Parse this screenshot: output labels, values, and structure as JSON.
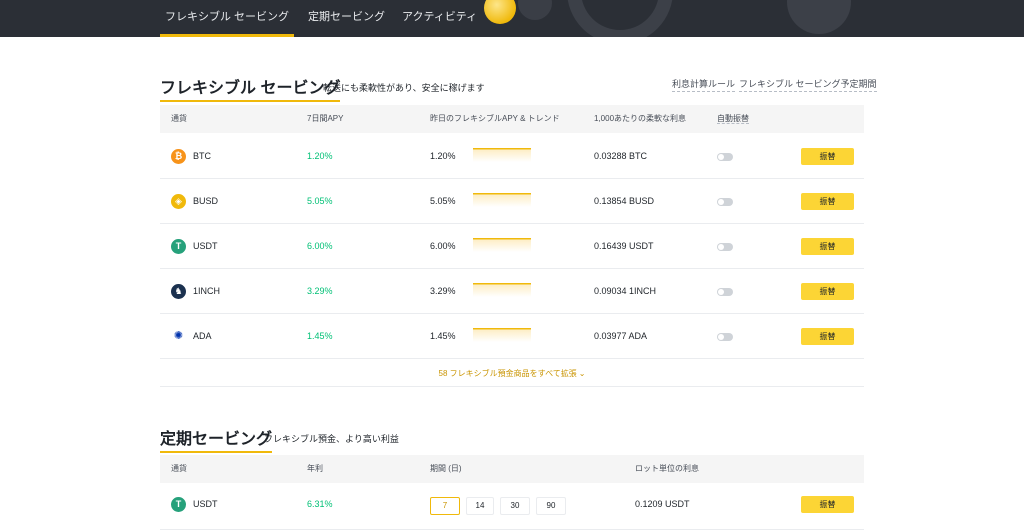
{
  "nav": {
    "tabs": [
      {
        "label": "フレキシブル セービング",
        "active": true
      },
      {
        "label": "定期セービング",
        "active": false
      },
      {
        "label": "アクティビティ",
        "active": false
      }
    ]
  },
  "flexible": {
    "title": "フレキシブル セービング",
    "subtitle": "転送にも柔軟性があり、安全に稼げます",
    "links": [
      "利息計算ルール",
      "フレキシブル セービング予定期間"
    ],
    "headers": [
      "通貨",
      "7日間APY",
      "昨日のフレキシブルAPY & トレンド",
      "1,000あたりの柔軟な利息",
      "自動振替"
    ],
    "rows": [
      {
        "coin": "BTC",
        "apy7": "1.20%",
        "yesterday": "1.20%",
        "interest": "0.03288 BTC",
        "button": "振替",
        "icon": "bitcoin-icon",
        "color": "#f7931a",
        "glyph": "₿"
      },
      {
        "coin": "BUSD",
        "apy7": "5.05%",
        "yesterday": "5.05%",
        "interest": "0.13854 BUSD",
        "button": "振替",
        "icon": "busd-icon",
        "color": "#f0b90b",
        "glyph": "◈"
      },
      {
        "coin": "USDT",
        "apy7": "6.00%",
        "yesterday": "6.00%",
        "interest": "0.16439 USDT",
        "button": "振替",
        "icon": "tether-icon",
        "color": "#26a17b",
        "glyph": "T"
      },
      {
        "coin": "1INCH",
        "apy7": "3.29%",
        "yesterday": "3.29%",
        "interest": "0.09034 1INCH",
        "button": "振替",
        "icon": "1inch-icon",
        "color": "#1b314f",
        "glyph": "♞"
      },
      {
        "coin": "ADA",
        "apy7": "1.45%",
        "yesterday": "1.45%",
        "interest": "0.03977 ADA",
        "button": "振替",
        "icon": "cardano-icon",
        "color": "#ffffff",
        "glyph": "✺"
      }
    ],
    "expand_label": "58 フレキシブル預金商品をすべて拡張"
  },
  "locked": {
    "title": "定期セービング",
    "subtitle": "フレキシブル預金、より高い利益",
    "headers": [
      "通貨",
      "年利",
      "期間 (日)",
      "ロット単位の利息"
    ],
    "rows": [
      {
        "coin": "USDT",
        "apr": "6.31%",
        "periods": [
          "7",
          "14",
          "30",
          "90"
        ],
        "selected_period": "7",
        "interest": "0.1209 USDT",
        "button": "振替",
        "icon": "tether-icon",
        "color": "#26a17b",
        "glyph": "T"
      }
    ]
  },
  "colors": {
    "accent": "#f0b90b",
    "button": "#fcd535",
    "positive": "#02c076",
    "nav_bg": "#2b2f36"
  }
}
